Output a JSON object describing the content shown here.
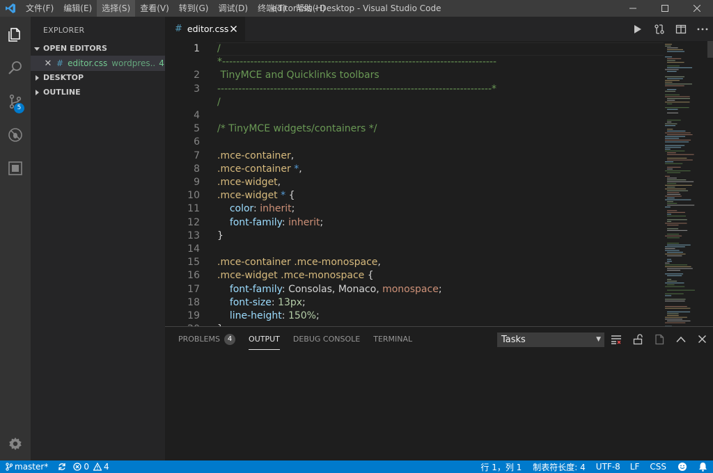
{
  "titlebar": {
    "menu": [
      "文件(F)",
      "编辑(E)",
      "选择(S)",
      "查看(V)",
      "转到(G)",
      "调试(D)",
      "终端(T)",
      "帮助(H)"
    ],
    "active_menu_index": 2,
    "window_title": "editor.css - Desktop - Visual Studio Code"
  },
  "activitybar": {
    "items": [
      "explorer-icon",
      "search-icon",
      "source-control-icon",
      "debug-icon",
      "extensions-icon"
    ],
    "scm_badge": "5",
    "settings_icon": "gear-icon"
  },
  "sidebar": {
    "title": "EXPLORER",
    "sections": {
      "open_editors": "OPEN EDITORS",
      "desktop": "DESKTOP",
      "outline": "OUTLINE"
    },
    "open_editor": {
      "name": "editor.css",
      "description": "wordpres...",
      "count": "4"
    }
  },
  "tabs": {
    "active": "editor.css"
  },
  "editor": {
    "current_line": 1,
    "lines": [
      {
        "num": "1",
        "tokens": [
          [
            "tok-comment",
            "/"
          ]
        ]
      },
      {
        "num": "",
        "tokens": [
          [
            "tok-comment",
            "*------------------------------------------------------------------------------"
          ]
        ]
      },
      {
        "num": "2",
        "tokens": [
          [
            "tok-comment",
            " TinyMCE and Quicklinks toolbars"
          ]
        ]
      },
      {
        "num": "3",
        "tokens": [
          [
            "tok-comment",
            "------------------------------------------------------------------------------*"
          ]
        ]
      },
      {
        "num": "",
        "tokens": [
          [
            "tok-comment",
            "/"
          ]
        ]
      },
      {
        "num": "4",
        "tokens": []
      },
      {
        "num": "5",
        "tokens": [
          [
            "tok-comment",
            "/* TinyMCE widgets/containers */"
          ]
        ]
      },
      {
        "num": "6",
        "tokens": []
      },
      {
        "num": "7",
        "tokens": [
          [
            "tok-selector",
            ".mce-container"
          ],
          [
            "tok-punct",
            ","
          ]
        ]
      },
      {
        "num": "8",
        "tokens": [
          [
            "tok-selector",
            ".mce-container "
          ],
          [
            "tok-star",
            "*"
          ],
          [
            "tok-punct",
            ","
          ]
        ]
      },
      {
        "num": "9",
        "tokens": [
          [
            "tok-selector",
            ".mce-widget"
          ],
          [
            "tok-punct",
            ","
          ]
        ]
      },
      {
        "num": "10",
        "tokens": [
          [
            "tok-selector",
            ".mce-widget "
          ],
          [
            "tok-star",
            "*"
          ],
          [
            "tok-punct",
            " {"
          ]
        ]
      },
      {
        "num": "11",
        "tokens": [
          [
            "tok-plain",
            "    "
          ],
          [
            "tok-property",
            "color"
          ],
          [
            "tok-punct",
            ": "
          ],
          [
            "tok-value",
            "inherit"
          ],
          [
            "tok-punct",
            ";"
          ]
        ]
      },
      {
        "num": "12",
        "tokens": [
          [
            "tok-plain",
            "    "
          ],
          [
            "tok-property",
            "font-family"
          ],
          [
            "tok-punct",
            ": "
          ],
          [
            "tok-value",
            "inherit"
          ],
          [
            "tok-punct",
            ";"
          ]
        ]
      },
      {
        "num": "13",
        "tokens": [
          [
            "tok-punct",
            "}"
          ]
        ]
      },
      {
        "num": "14",
        "tokens": []
      },
      {
        "num": "15",
        "tokens": [
          [
            "tok-selector",
            ".mce-container .mce-monospace"
          ],
          [
            "tok-punct",
            ","
          ]
        ]
      },
      {
        "num": "16",
        "tokens": [
          [
            "tok-selector",
            ".mce-widget .mce-monospace"
          ],
          [
            "tok-punct",
            " {"
          ]
        ]
      },
      {
        "num": "17",
        "tokens": [
          [
            "tok-plain",
            "    "
          ],
          [
            "tok-property",
            "font-family"
          ],
          [
            "tok-punct",
            ": "
          ],
          [
            "tok-plain",
            "Consolas, Monaco, "
          ],
          [
            "tok-value",
            "monospace"
          ],
          [
            "tok-punct",
            ";"
          ]
        ]
      },
      {
        "num": "18",
        "tokens": [
          [
            "tok-plain",
            "    "
          ],
          [
            "tok-property",
            "font-size"
          ],
          [
            "tok-punct",
            ": "
          ],
          [
            "tok-number",
            "13px"
          ],
          [
            "tok-punct",
            ";"
          ]
        ]
      },
      {
        "num": "19",
        "tokens": [
          [
            "tok-plain",
            "    "
          ],
          [
            "tok-property",
            "line-height"
          ],
          [
            "tok-punct",
            ": "
          ],
          [
            "tok-number",
            "150%"
          ],
          [
            "tok-punct",
            ";"
          ]
        ]
      },
      {
        "num": "20",
        "tokens": [
          [
            "tok-punct",
            "}"
          ]
        ]
      }
    ]
  },
  "panel": {
    "tabs": [
      {
        "label": "PROBLEMS",
        "badge": "4",
        "active": false
      },
      {
        "label": "OUTPUT",
        "badge": "",
        "active": true
      },
      {
        "label": "DEBUG CONSOLE",
        "badge": "",
        "active": false
      },
      {
        "label": "TERMINAL",
        "badge": "",
        "active": false
      }
    ],
    "select_value": "Tasks"
  },
  "statusbar": {
    "branch": "master*",
    "errors": "0",
    "warnings": "4",
    "position": "行 1，列 1",
    "indent": "制表符长度: 4",
    "encoding": "UTF-8",
    "eol": "LF",
    "language": "CSS"
  },
  "colors": {
    "accent": "#007acc",
    "titlebar": "#3c3c3c",
    "activitybar": "#333333",
    "sidebar": "#252526",
    "editor": "#1e1e1e"
  }
}
